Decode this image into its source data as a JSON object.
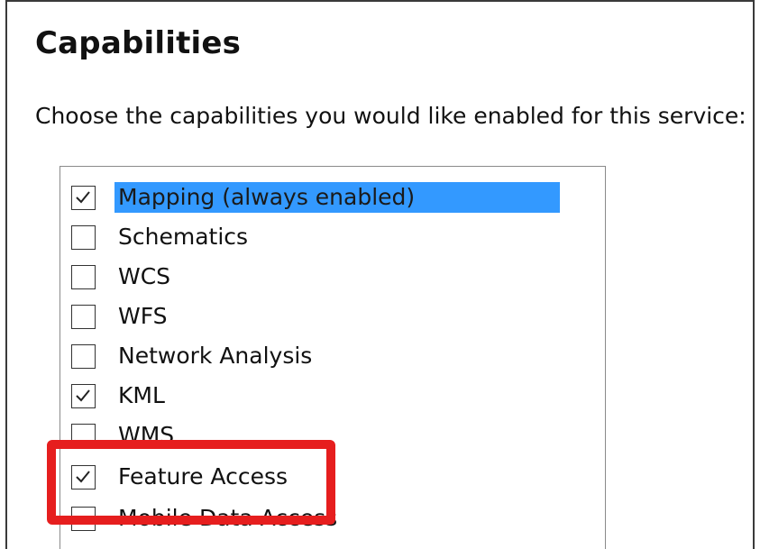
{
  "panel": {
    "title": "Capabilities",
    "instructions": "Choose the capabilities you would like enabled for this service:"
  },
  "capabilities": [
    {
      "label": "Mapping (always enabled)",
      "checked": true,
      "selected": true
    },
    {
      "label": "Schematics",
      "checked": false,
      "selected": false
    },
    {
      "label": "WCS",
      "checked": false,
      "selected": false
    },
    {
      "label": "WFS",
      "checked": false,
      "selected": false
    },
    {
      "label": "Network Analysis",
      "checked": false,
      "selected": false
    },
    {
      "label": "KML",
      "checked": true,
      "selected": false
    },
    {
      "label": "WMS",
      "checked": false,
      "selected": false
    },
    {
      "label": "Feature Access",
      "checked": true,
      "selected": false
    },
    {
      "label": "Mobile Data Access",
      "checked": false,
      "selected": false
    }
  ],
  "colors": {
    "selection": "#3399ff",
    "highlight_box": "#e61e1e"
  }
}
